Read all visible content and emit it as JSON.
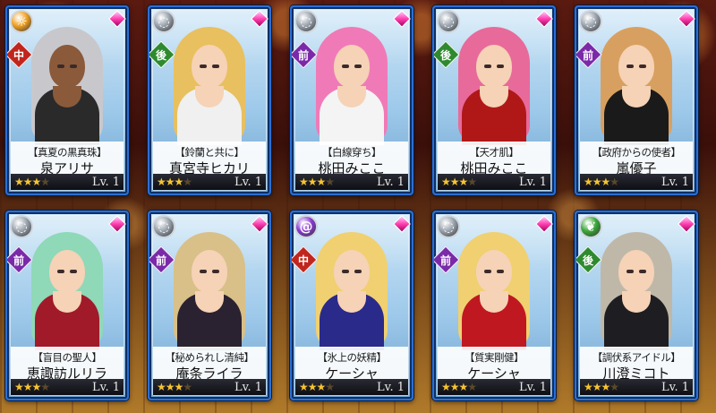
{
  "cards": [
    {
      "subtitle": "【真夏の黒真珠】",
      "name": "泉アリサ",
      "position": "中",
      "position_color": "#c0261d",
      "element_icon": "sun-icon",
      "element_color": "#f0a020",
      "rarity": 3,
      "rarity_max": 4,
      "level": "Lv. 1",
      "hair_color": "#c8c8cc",
      "outfit_color": "#2a2a2a",
      "skin": "dark"
    },
    {
      "subtitle": "【鈴蘭と共に】",
      "name": "真宮寺ヒカリ",
      "position": "後",
      "position_color": "#2f8a2f",
      "element_icon": "water-icon",
      "element_color": "#9aa3ad",
      "rarity": 3,
      "rarity_max": 4,
      "level": "Lv. 1",
      "hair_color": "#e8c060",
      "outfit_color": "#f0f0f0",
      "skin": "light"
    },
    {
      "subtitle": "【白線穿ち】",
      "name": "桃田みここ",
      "position": "前",
      "position_color": "#7a2aa8",
      "element_icon": "water-icon",
      "element_color": "#9aa3ad",
      "rarity": 3,
      "rarity_max": 4,
      "level": "Lv. 1",
      "hair_color": "#f07ab8",
      "outfit_color": "#f4f4f4",
      "skin": "light"
    },
    {
      "subtitle": "【天才肌】",
      "name": "桃田みここ",
      "position": "後",
      "position_color": "#2f8a2f",
      "element_icon": "water-icon",
      "element_color": "#9aa3ad",
      "rarity": 3,
      "rarity_max": 4,
      "level": "Lv. 1",
      "hair_color": "#e86a9a",
      "outfit_color": "#b01818",
      "skin": "light"
    },
    {
      "subtitle": "【政府からの使者】",
      "name": "嵐優子",
      "position": "前",
      "position_color": "#7a2aa8",
      "element_icon": "water-icon",
      "element_color": "#9aa3ad",
      "rarity": 3,
      "rarity_max": 4,
      "level": "Lv. 1",
      "hair_color": "#d8a060",
      "outfit_color": "#1a1a1a",
      "skin": "light"
    },
    {
      "subtitle": "【盲目の聖人】",
      "name": "恵諏訪ルリラ",
      "position": "前",
      "position_color": "#7a2aa8",
      "element_icon": "water-icon",
      "element_color": "#9aa3ad",
      "rarity": 3,
      "rarity_max": 4,
      "level": "Lv. 1",
      "hair_color": "#8fd8b8",
      "outfit_color": "#a01a2a",
      "skin": "light"
    },
    {
      "subtitle": "【秘められし清純】",
      "name": "庵条ライラ",
      "position": "前",
      "position_color": "#7a2aa8",
      "element_icon": "water-icon",
      "element_color": "#9aa3ad",
      "rarity": 3,
      "rarity_max": 4,
      "level": "Lv. 1",
      "hair_color": "#d8c088",
      "outfit_color": "#2a2230",
      "skin": "light"
    },
    {
      "subtitle": "【氷上の妖精】",
      "name": "ケーシャ",
      "position": "中",
      "position_color": "#c0261d",
      "element_icon": "spiral-icon",
      "element_color": "#8a3ad0",
      "rarity": 3,
      "rarity_max": 4,
      "level": "Lv. 1",
      "hair_color": "#f0d070",
      "outfit_color": "#2a2a8a",
      "skin": "light"
    },
    {
      "subtitle": "【質実剛健】",
      "name": "ケーシャ",
      "position": "前",
      "position_color": "#7a2aa8",
      "element_icon": "water-icon",
      "element_color": "#9aa3ad",
      "rarity": 3,
      "rarity_max": 4,
      "level": "Lv. 1",
      "hair_color": "#f0d070",
      "outfit_color": "#c01820",
      "skin": "light"
    },
    {
      "subtitle": "【調伏系アイドル】",
      "name": "川澄ミコト",
      "position": "後",
      "position_color": "#2f8a2f",
      "element_icon": "leaf-icon",
      "element_color": "#3aa83a",
      "rarity": 3,
      "rarity_max": 4,
      "level": "Lv. 1",
      "hair_color": "#bfb8a8",
      "outfit_color": "#1e1e22",
      "skin": "light"
    }
  ]
}
